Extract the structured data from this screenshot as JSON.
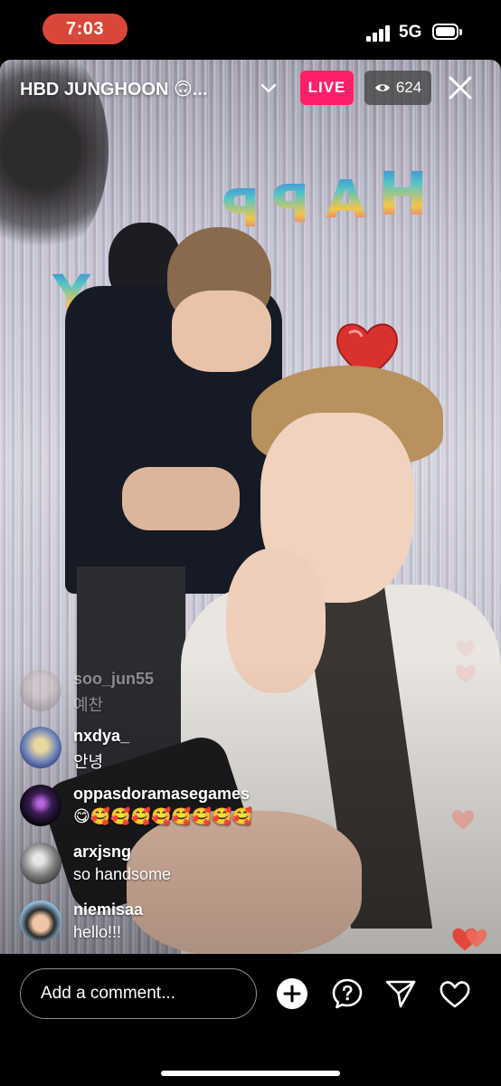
{
  "status_bar": {
    "time": "7:03",
    "network": "5G"
  },
  "stream": {
    "title": "HBD JUNGHOON 🙃...",
    "live_label": "LIVE",
    "viewer_count": "624",
    "balloon_text": "HAPPY"
  },
  "comments": [
    {
      "username": "soo_jun55",
      "text": "예찬",
      "faded": true
    },
    {
      "username": "nxdya_",
      "text": "안녕"
    },
    {
      "username": "oppasdoramasegames",
      "text": "😋🥰🥰🥰🥰🥰🥰🥰🥰"
    },
    {
      "username": "arxjsng",
      "text": "so handsome"
    },
    {
      "username": "niemisaa",
      "text": "hello!!!"
    }
  ],
  "composer": {
    "placeholder": "Add a comment..."
  },
  "colors": {
    "live": "#ff1f68",
    "time_pill": "#d9473b",
    "heart": "#e2463d"
  },
  "icons": [
    "eye-icon",
    "chevron-down-icon",
    "close-icon",
    "add-icon",
    "question-icon",
    "send-icon",
    "heart-icon"
  ]
}
